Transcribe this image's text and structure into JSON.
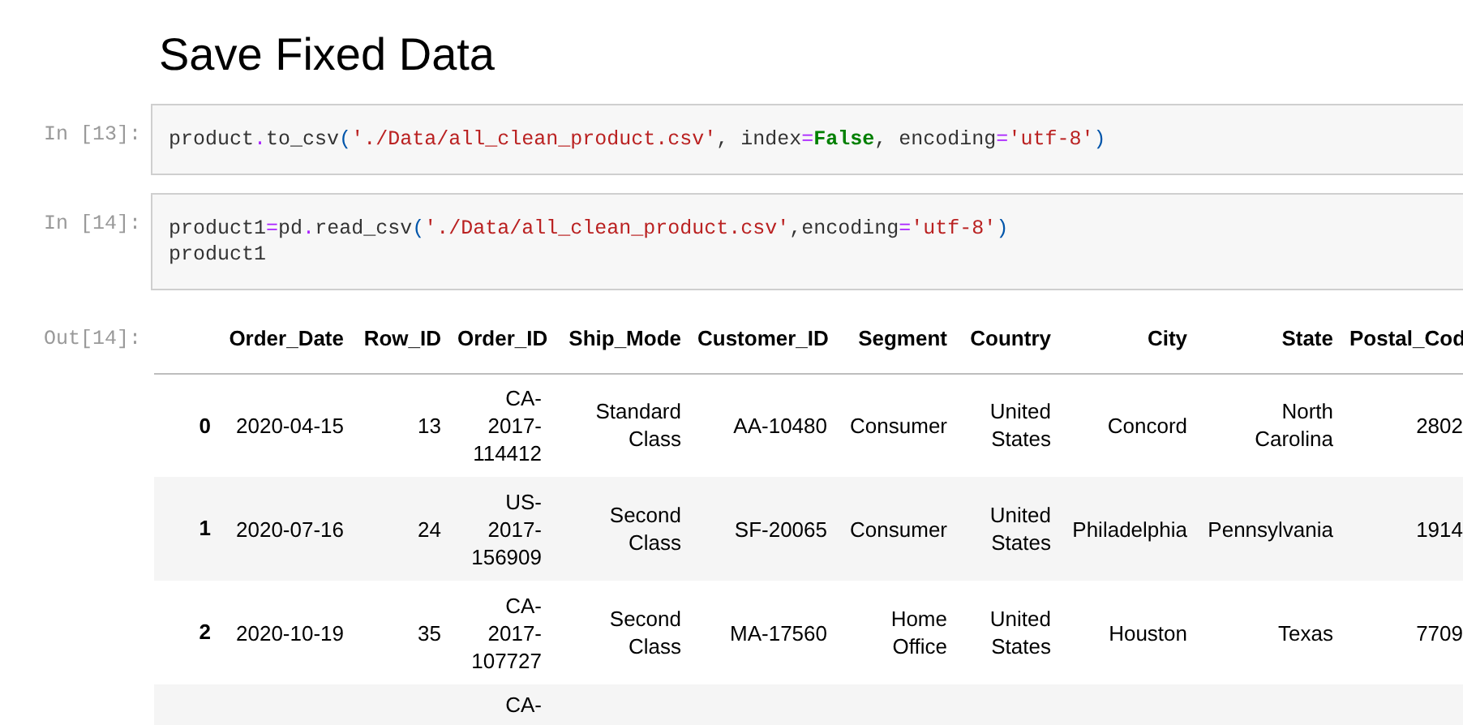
{
  "heading": "Save Fixed Data",
  "cells": [
    {
      "prompt": "In [13]:",
      "lines": [
        [
          {
            "text": "product",
            "kind": "name"
          },
          {
            "text": ".",
            "kind": "op"
          },
          {
            "text": "to_csv",
            "kind": "name"
          },
          {
            "text": "(",
            "kind": "paren"
          },
          {
            "text": "'./Data/all_clean_product.csv'",
            "kind": "str"
          },
          {
            "text": ", index",
            "kind": "name"
          },
          {
            "text": "=",
            "kind": "op"
          },
          {
            "text": "False",
            "kind": "kw"
          },
          {
            "text": ", encoding",
            "kind": "name"
          },
          {
            "text": "=",
            "kind": "op"
          },
          {
            "text": "'utf-8'",
            "kind": "str"
          },
          {
            "text": ")",
            "kind": "paren"
          }
        ]
      ]
    },
    {
      "prompt": "In [14]:",
      "lines": [
        [
          {
            "text": "product1",
            "kind": "name"
          },
          {
            "text": "=",
            "kind": "op"
          },
          {
            "text": "pd",
            "kind": "name"
          },
          {
            "text": ".",
            "kind": "op"
          },
          {
            "text": "read_csv",
            "kind": "name"
          },
          {
            "text": "(",
            "kind": "paren"
          },
          {
            "text": "'./Data/all_clean_product.csv'",
            "kind": "str"
          },
          {
            "text": ",encoding",
            "kind": "name"
          },
          {
            "text": "=",
            "kind": "op"
          },
          {
            "text": "'utf-8'",
            "kind": "str"
          },
          {
            "text": ")",
            "kind": "paren"
          }
        ],
        [
          {
            "text": "product1",
            "kind": "name"
          }
        ]
      ]
    }
  ],
  "output": {
    "prompt": "Out[14]:",
    "table": {
      "columns": [
        "Order_Date",
        "Row_ID",
        "Order_ID",
        "Ship_Mode",
        "Customer_ID",
        "Segment",
        "Country",
        "City",
        "State",
        "Postal_Cod"
      ],
      "rows": [
        {
          "index": "0",
          "cells": [
            "2020-04-15",
            "13",
            "CA-2017-114412",
            "Standard Class",
            "AA-10480",
            "Consumer",
            "United States",
            "Concord",
            "North Carolina",
            "2802"
          ]
        },
        {
          "index": "1",
          "cells": [
            "2020-07-16",
            "24",
            "US-2017-156909",
            "Second Class",
            "SF-20065",
            "Consumer",
            "United States",
            "Philadelphia",
            "Pennsylvania",
            "1914"
          ]
        },
        {
          "index": "2",
          "cells": [
            "2020-10-19",
            "35",
            "CA-2017-107727",
            "Second Class",
            "MA-17560",
            "Home Office",
            "United States",
            "Houston",
            "Texas",
            "7709"
          ]
        },
        {
          "cells": [
            null,
            null,
            "CA-",
            null,
            null,
            null,
            null,
            null,
            null,
            null
          ]
        }
      ]
    }
  }
}
